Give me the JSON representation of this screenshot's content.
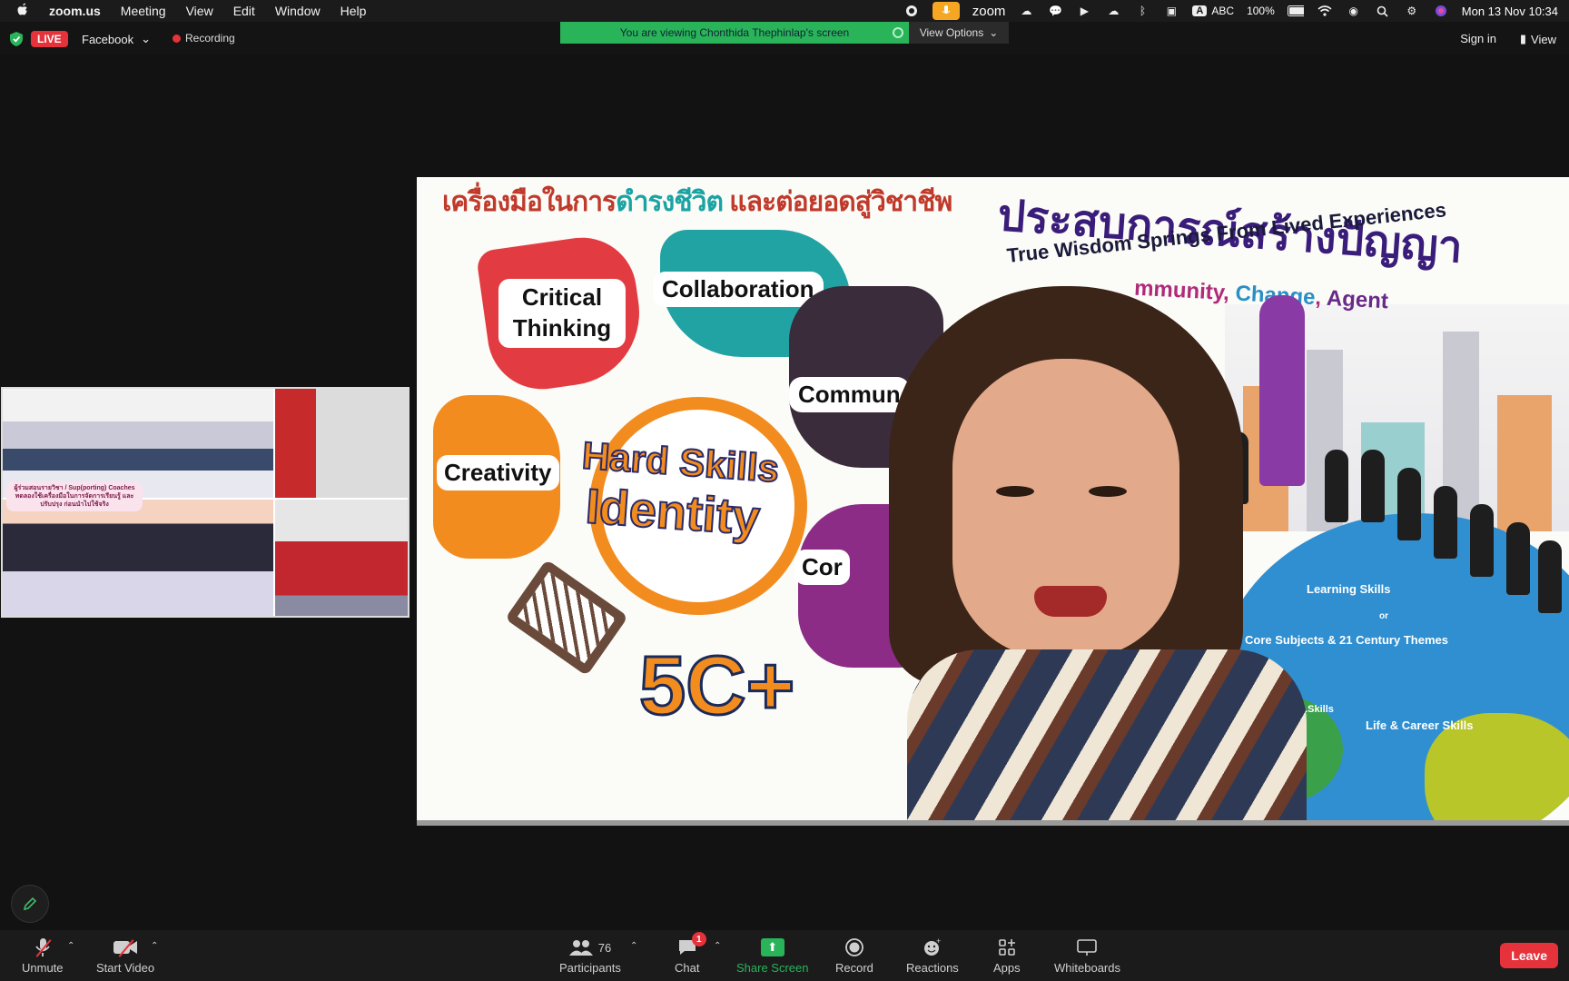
{
  "menubar": {
    "apple": "",
    "items": [
      "zoom.us",
      "Meeting",
      "View",
      "Edit",
      "Window",
      "Help"
    ],
    "right": {
      "zoom": "zoom",
      "input_box": "A",
      "input": "ABC",
      "battery": "100%",
      "clock": "Mon 13 Nov  10:34"
    }
  },
  "topbar": {
    "live": "LIVE",
    "stream_target": "Facebook",
    "recording": "Recording",
    "viewing": "You are viewing Chonthida Thephinlap's screen",
    "view_options": "View Options",
    "sign_in": "Sign in",
    "view": "View"
  },
  "slide": {
    "header_thai_a": "เครื่องมือในการ",
    "header_thai_b": "ดำรงชีวิต",
    "header_thai_c": " และต่อยอดสู่วิชาชีพ",
    "wisdom_thai": "ประสบการณ์สร้างปัญญา",
    "wisdom_en": "True Wisdom Springs From Lived Experiences",
    "cca_1": "mmunity",
    "cca_2": "Change",
    "cca_3": "Agent",
    "critical": "Critical Thinking",
    "collaboration": "Collaboration",
    "communication": "Commun",
    "creativity": "Creativity",
    "cor": "Cor",
    "hard_skills": "Hard Skills",
    "identity": "Identity",
    "fivec": "5C+",
    "globe_learning": "Learning Skills",
    "globe_or": "or",
    "globe_core": "Core Subjects & 21 Century Themes",
    "globe_media": "...lion Media ...Skills",
    "globe_life": "Life & Career Skills"
  },
  "thumbnail": {
    "caption": "ผู้ร่วมสอนรายวิชา / Sup(porting) Coaches ทดลองใช้เครื่องมือในการจัดการเรียนรู้ และ ปรับปรุง ก่อนนำไปใช้จริง"
  },
  "toolbar": {
    "unmute": "Unmute",
    "start_video": "Start Video",
    "participants": "Participants",
    "participants_count": "76",
    "chat": "Chat",
    "chat_badge": "1",
    "share_screen": "Share Screen",
    "record": "Record",
    "reactions": "Reactions",
    "apps": "Apps",
    "whiteboards": "Whiteboards",
    "leave": "Leave"
  }
}
